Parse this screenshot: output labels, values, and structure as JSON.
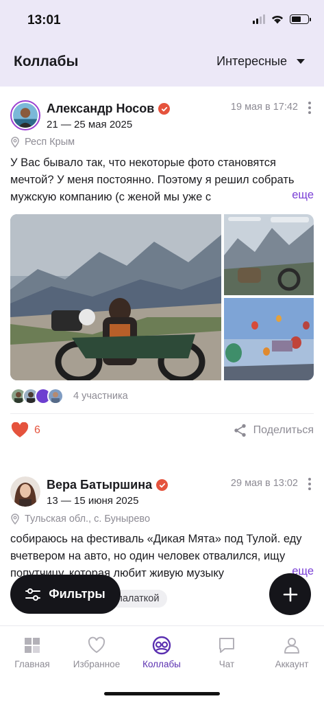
{
  "status_bar": {
    "time": "13:01",
    "battery_level": 0.6,
    "signal_bars": 2
  },
  "header": {
    "title": "Коллабы",
    "sort_label": "Интересные"
  },
  "posts": [
    {
      "author": "Александр Носов",
      "verified": true,
      "dates": "21 — 25 мая 2025",
      "posted_at": "19 мая в 17:42",
      "location": "Респ Крым",
      "text": "У Вас бывало так, что некоторые фото становятся мечтой? У меня постоянно. Поэтому я решил собрать мужскую компанию (с женой мы уже с",
      "more_label": "еще",
      "participants_label": "4 участника",
      "likes": "6",
      "share_label": "Поделиться"
    },
    {
      "author": "Вера Батыршина",
      "verified": true,
      "dates": "13 — 15 июня 2025",
      "posted_at": "29 мая в 13:02",
      "location": "Тульская обл., с. Бунырево",
      "text": "собираюсь на фестиваль «Дикая Мята» под Тулой. еду вчетвером на авто, но один человек отвалился, ищу попутчицу, которая любит живую музыку",
      "more_label": "еще",
      "tag": "палаткой"
    }
  ],
  "floating": {
    "filters_label": "Фильтры"
  },
  "tabbar": {
    "items": [
      {
        "label": "Главная",
        "icon": "grid-icon"
      },
      {
        "label": "Избранное",
        "icon": "heart-outline-icon"
      },
      {
        "label": "Коллабы",
        "icon": "collab-icon",
        "active": true
      },
      {
        "label": "Чат",
        "icon": "chat-icon"
      },
      {
        "label": "Аккаунт",
        "icon": "person-icon"
      }
    ]
  },
  "colors": {
    "accent": "#5a2fb0",
    "like": "#e5533d",
    "header_bg": "#ece8f7",
    "muted": "#8d8b94"
  }
}
